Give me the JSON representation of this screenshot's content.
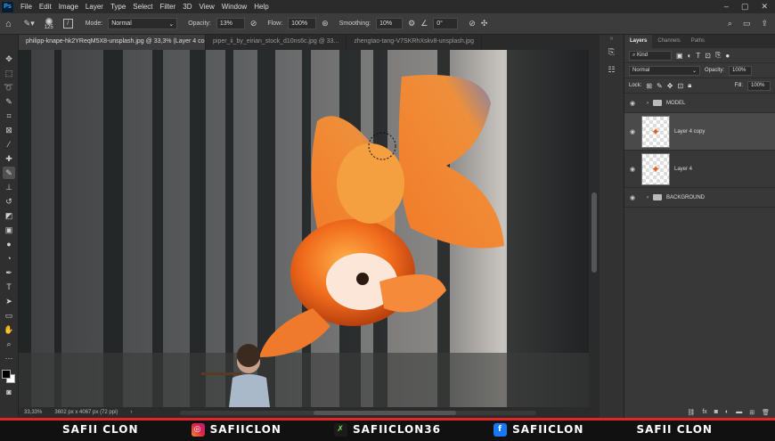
{
  "menubar": {
    "app_icon": "Ps",
    "items": [
      "File",
      "Edit",
      "Image",
      "Layer",
      "Type",
      "Select",
      "Filter",
      "3D",
      "View",
      "Window",
      "Help"
    ]
  },
  "options": {
    "brush_size": "125",
    "mode_label": "Mode:",
    "mode_value": "Normal",
    "opacity_label": "Opacity:",
    "opacity_value": "13%",
    "flow_label": "Flow:",
    "flow_value": "100%",
    "smoothing_label": "Smoothing:",
    "smoothing_value": "10%",
    "angle_value": "0°"
  },
  "tabs": [
    {
      "label": "philipp-knape-hk2YReqM5X8-unsplash.jpg @ 33,3% (Layer 4 copy, RGB/8) *"
    },
    {
      "label": "piper_ii_by_eirian_stock_d10ns6c.jpg @ 33..."
    },
    {
      "label": "zhengtao-tang-V7SKRhXskv8-unsplash.jpg"
    }
  ],
  "status": {
    "zoom": "33,33%",
    "doc_info": "3602 px x 4067 px (72 ppi)"
  },
  "layers_panel": {
    "tabs": [
      "Layers",
      "Channels",
      "Paths"
    ],
    "filter_kind": "Kind",
    "blend_mode": "Normal",
    "opacity_label": "Opacity:",
    "opacity_value": "100%",
    "lock_label": "Lock:",
    "fill_label": "Fill:",
    "fill_value": "100%",
    "layers": [
      {
        "name": "MODEL",
        "type": "group"
      },
      {
        "name": "Layer 4 copy",
        "type": "pixel",
        "selected": true
      },
      {
        "name": "Layer 4",
        "type": "pixel"
      },
      {
        "name": "BACKGROUND",
        "type": "group"
      }
    ]
  },
  "banner": {
    "left": "SAFII CLON",
    "instagram": "SAFIICLON",
    "x": "SAFIICLON36",
    "facebook": "SAFIICLON",
    "right": "SAFII CLON"
  },
  "colors": {
    "accent": "#31a8ff",
    "banner_red": "#e0262a",
    "fish_orange": "#f06a1c"
  }
}
